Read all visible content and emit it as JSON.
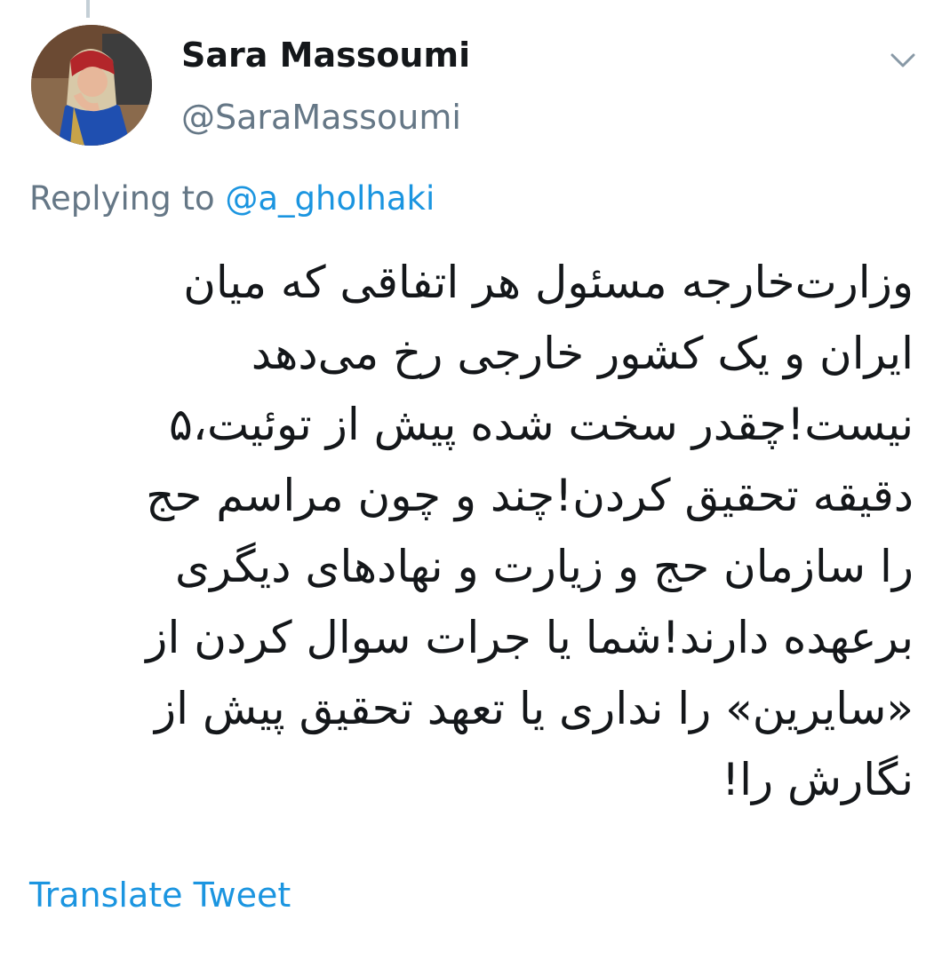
{
  "tweet": {
    "author": {
      "display_name": "Sara Massoumi",
      "handle": "@SaraMassoumi",
      "avatar_icon": "user-avatar"
    },
    "reply": {
      "prefix": "Replying to",
      "mention": "@a_gholhaki"
    },
    "text_lines": [
      "وزارت‌خارجه مسئول هر اتفاقی که میان",
      "ایران و یک کشور خارجی رخ می‌دهد",
      "نیست!چقدر سخت شده پیش از توئیت،۵",
      "دقیقه تحقیق کردن!چند و چون مراسم حج",
      "را سازمان حج و زیارت و نهادهای دیگری",
      "برعهده دارند!شما یا جرات سوال کردن از",
      "«سایرین» را نداری یا تعهد تحقیق پیش از",
      "نگارش را!"
    ],
    "translate_label": "Translate Tweet",
    "menu_icon": "chevron-down-icon"
  },
  "colors": {
    "text": "#14171a",
    "secondary": "#657786",
    "link": "#1b95e0",
    "thread_line": "#c4cfd6"
  }
}
